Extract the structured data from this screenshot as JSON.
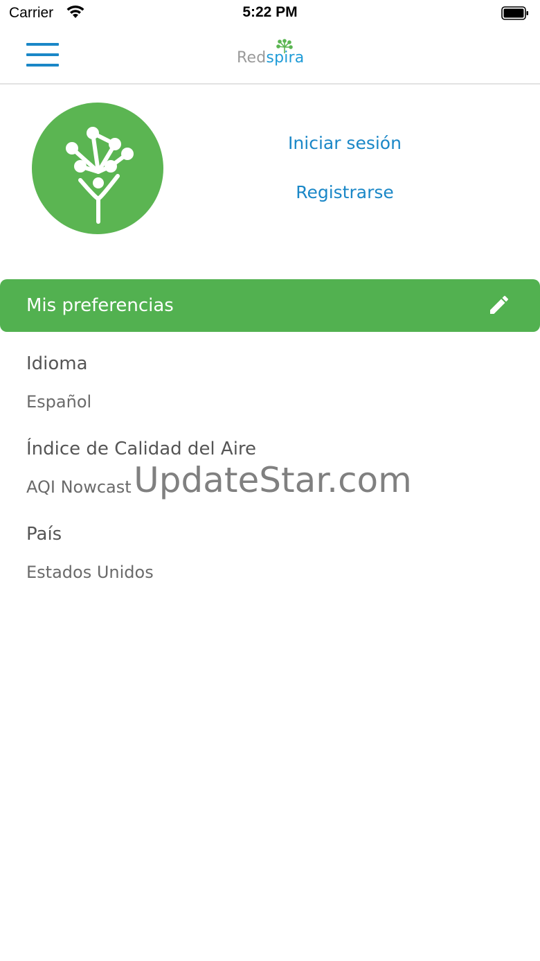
{
  "status_bar": {
    "carrier": "Carrier",
    "time": "5:22 PM",
    "icons": [
      "wifi-icon",
      "battery-icon"
    ]
  },
  "nav_bar": {
    "menu_icon": "hamburger-menu-icon",
    "logo": {
      "part1": "Red",
      "part2": "spira",
      "colors": {
        "part1": "#9a9a9a",
        "part2": "#1e9bd7"
      }
    }
  },
  "profile": {
    "avatar_icon": "tree-network-icon",
    "login_label": "Iniciar sesión",
    "register_label": "Registrarse"
  },
  "preferences": {
    "title": "Mis preferencias",
    "edit_icon": "pencil-icon",
    "items": [
      {
        "label": "Idioma",
        "value": "Español"
      },
      {
        "label": "Índice de Calidad del Aire",
        "value": "AQI Nowcast"
      },
      {
        "label": "País",
        "value": "Estados Unidos"
      }
    ]
  },
  "watermark": "UpdateStar.com",
  "colors": {
    "accent_blue": "#1a87c7",
    "brand_green": "#52b150",
    "avatar_green": "#5bb552"
  }
}
